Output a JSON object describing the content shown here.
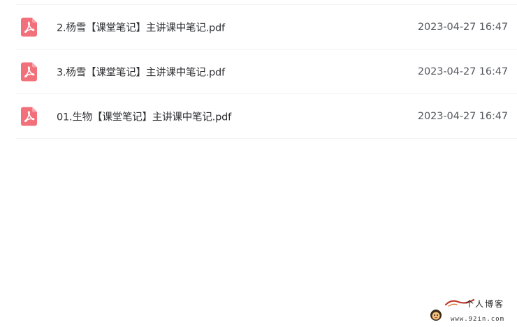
{
  "files": [
    {
      "name": "2.杨雪【课堂笔记】主讲课中笔记.pdf",
      "time": "2023-04-27 16:47",
      "icon": "pdf-icon"
    },
    {
      "name": "3.杨雪【课堂笔记】主讲课中笔记.pdf",
      "time": "2023-04-27 16:47",
      "icon": "pdf-icon"
    },
    {
      "name": "01.生物【课堂笔记】主讲课中笔记.pdf",
      "time": "2023-04-27 16:47",
      "icon": "pdf-icon"
    }
  ],
  "watermark": {
    "title": "个人博客",
    "url": "www.92in.com"
  },
  "colors": {
    "pdf_icon": "#f2707a",
    "divider": "#f1f2f4",
    "name_text": "#2f3033",
    "time_text": "#55585e"
  }
}
